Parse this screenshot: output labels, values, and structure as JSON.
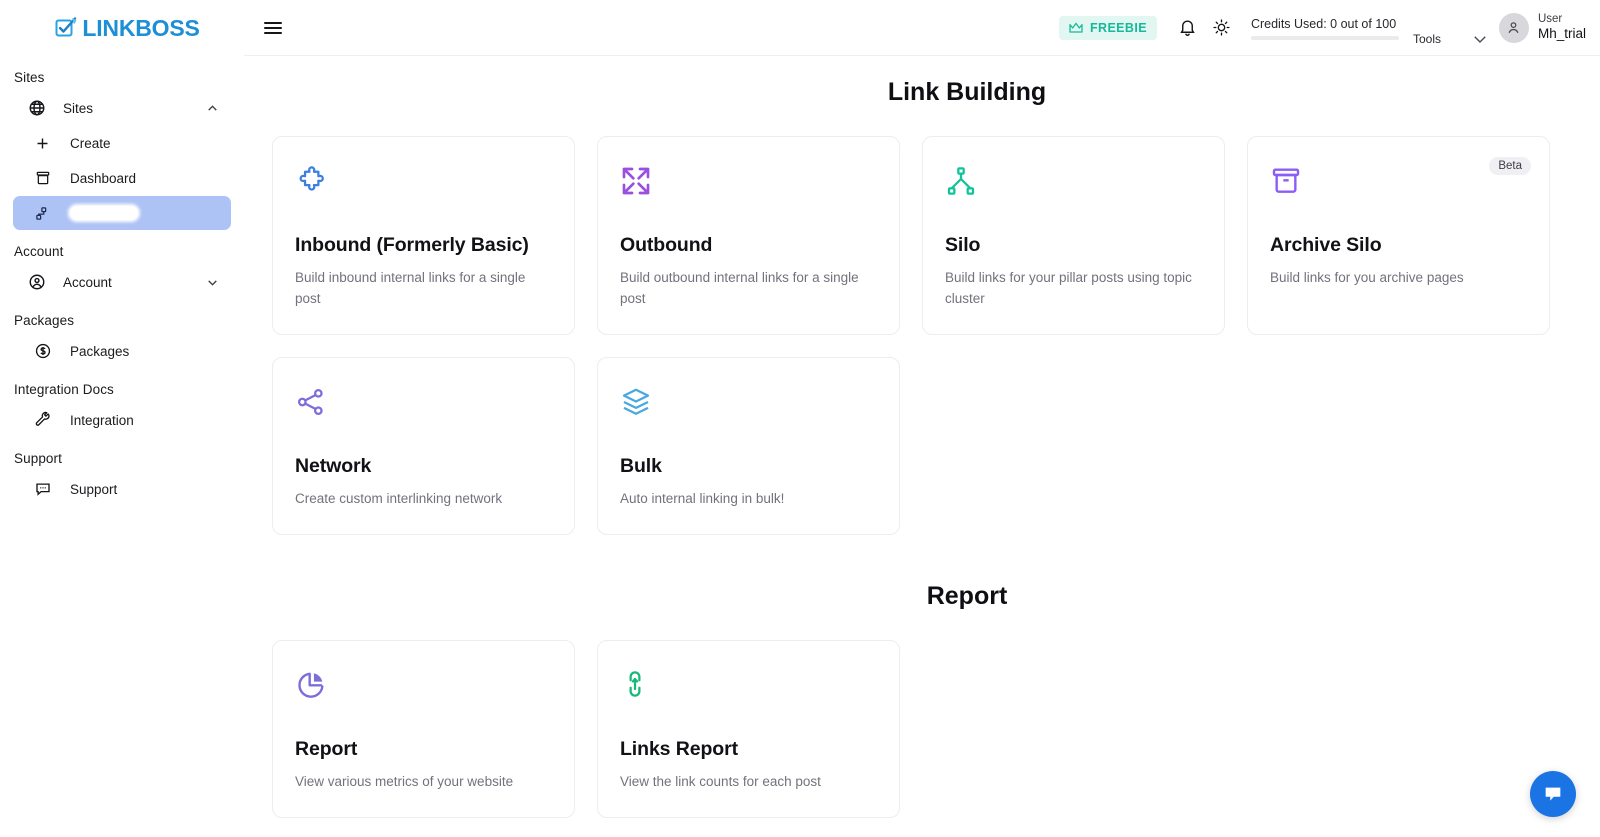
{
  "brand": {
    "logo_text": "LINKBOSS",
    "logo_icon": "checkbox-pen-icon",
    "logo_color": "#1c8fd6"
  },
  "sidebar": {
    "sections": [
      {
        "label": "Sites"
      },
      {
        "label": "Account"
      },
      {
        "label": "Packages"
      },
      {
        "label": "Integration Docs"
      },
      {
        "label": "Support"
      }
    ],
    "items": [
      {
        "label": "Sites",
        "icon": "globe-icon",
        "chevron": "chevron-up-icon",
        "active": false
      },
      {
        "label": "Create",
        "icon": "plus-icon",
        "active": false
      },
      {
        "label": "Dashboard",
        "icon": "archive-box-icon",
        "active": false
      },
      {
        "label": "",
        "icon": "sitemap-icon",
        "active": true,
        "redacted": true
      },
      {
        "label": "Account",
        "icon": "user-circle-icon",
        "chevron": "chevron-down-icon",
        "active": false
      },
      {
        "label": "Packages",
        "icon": "dollar-circle-icon",
        "active": false
      },
      {
        "label": "Integration",
        "icon": "wrench-icon",
        "active": false
      },
      {
        "label": "Support",
        "icon": "chat-dots-icon",
        "active": false
      }
    ],
    "active_highlight_color": "#aec3f5"
  },
  "topbar": {
    "menu_icon": "hamburger-icon",
    "plan_badge": {
      "label": "FREEBIE",
      "icon": "crown-icon",
      "color": "#18b89a",
      "bg": "#e2f7f2"
    },
    "notification_icon": "bell-icon",
    "theme_icon": "sun-icon",
    "credits": {
      "text": "Credits Used: 0 out of 100",
      "used": 0,
      "total": 100,
      "percent": 0
    },
    "tools_label": "Tools",
    "tools_chevron": "chevron-down-icon",
    "user": {
      "role": "User",
      "name": "Mh_trial",
      "avatar_icon": "person-icon"
    }
  },
  "main": {
    "link_building_heading": "Link Building",
    "report_heading": "Report",
    "link_building_cards": [
      {
        "title": "Inbound (Formerly Basic)",
        "desc": "Build inbound internal links for a single post",
        "icon": "puzzle-piece-icon",
        "color": "#3b7fe0"
      },
      {
        "title": "Outbound",
        "desc": "Build outbound internal links for a single post",
        "icon": "expand-arrows-icon",
        "color": "#9b4fe0"
      },
      {
        "title": "Silo",
        "desc": "Build links for your pillar posts using topic cluster",
        "icon": "hierarchy-tree-icon",
        "color": "#12c39a"
      },
      {
        "title": "Archive Silo",
        "desc": "Build links for you archive pages",
        "icon": "archive-icon",
        "color": "#8b5cf6",
        "badge": "Beta"
      },
      {
        "title": "Network",
        "desc": "Create custom interlinking network",
        "icon": "share-nodes-icon",
        "color": "#7c6ddb"
      },
      {
        "title": "Bulk",
        "desc": "Auto internal linking in bulk!",
        "icon": "layers-icon",
        "color": "#4aa8e0"
      }
    ],
    "report_cards": [
      {
        "title": "Report",
        "desc": "View various metrics of your website",
        "icon": "pie-chart-icon",
        "color": "#7c6ddb"
      },
      {
        "title": "Links Report",
        "desc": "View the link counts for each post",
        "icon": "link-icon",
        "color": "#17b978"
      }
    ]
  },
  "chat_widget": {
    "icon": "chat-bubble-icon",
    "color": "#1b74e4"
  }
}
